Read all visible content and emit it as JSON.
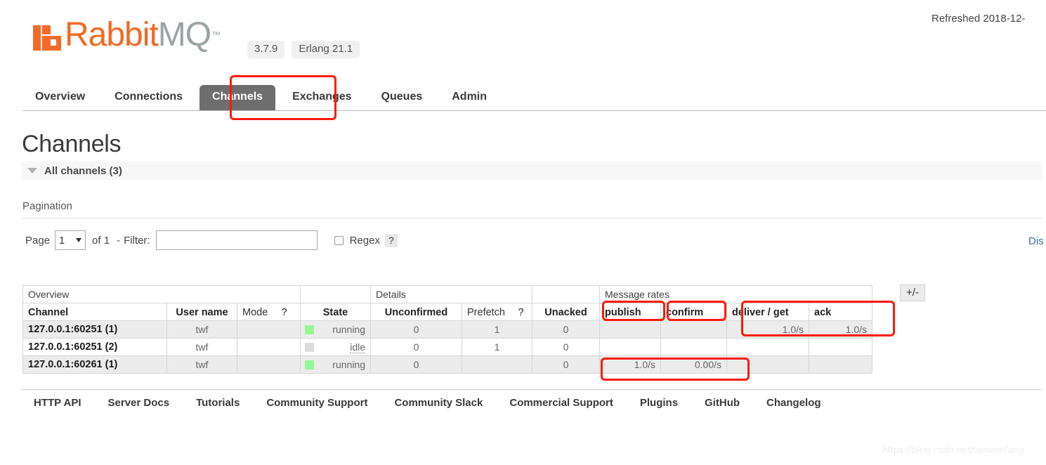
{
  "header": {
    "refreshed": "Refreshed 2018-12-",
    "logo_rabbit": "Rabbit",
    "logo_mq": "MQ",
    "logo_tm": "™",
    "version": "3.7.9",
    "erlang_version": "Erlang 21.1"
  },
  "nav": {
    "items": [
      {
        "label": "Overview",
        "active": false
      },
      {
        "label": "Connections",
        "active": false
      },
      {
        "label": "Channels",
        "active": true
      },
      {
        "label": "Exchanges",
        "active": false
      },
      {
        "label": "Queues",
        "active": false
      },
      {
        "label": "Admin",
        "active": false
      }
    ]
  },
  "page": {
    "title": "Channels",
    "section_title": "All channels (3)"
  },
  "pagination": {
    "label": "Pagination",
    "page_label": "Page",
    "page_value": "1",
    "of_text": "of 1",
    "dash": "-",
    "filter_label": "Filter:",
    "filter_value": "",
    "regex_label": "Regex",
    "help_marker": "?",
    "displaying": "Dis"
  },
  "table": {
    "group_headers": [
      {
        "label": "Overview",
        "span": 4
      },
      {
        "label": "Details",
        "span": 3
      },
      {
        "label": "Message rates",
        "span": 4
      }
    ],
    "columns": [
      "Channel",
      "User name",
      "Mode",
      "?",
      "State",
      "Unconfirmed",
      "Prefetch",
      "?",
      "Unacked",
      "publish",
      "confirm",
      "deliver / get",
      "ack"
    ],
    "rows": [
      {
        "channel": "127.0.0.1:60251 (1)",
        "user_name": "twf",
        "mode": "",
        "state": "running",
        "state_color": "green",
        "unconfirmed": "0",
        "prefetch": "1",
        "unacked": "0",
        "publish": "",
        "confirm": "",
        "deliver_get": "1.0/s",
        "ack": "1.0/s"
      },
      {
        "channel": "127.0.0.1:60251 (2)",
        "user_name": "twf",
        "mode": "",
        "state": "idle",
        "state_color": "grey",
        "unconfirmed": "0",
        "prefetch": "1",
        "unacked": "0",
        "publish": "",
        "confirm": "",
        "deliver_get": "",
        "ack": ""
      },
      {
        "channel": "127.0.0.1:60261 (1)",
        "user_name": "twf",
        "mode": "",
        "state": "running",
        "state_color": "green",
        "unconfirmed": "0",
        "prefetch": "",
        "unacked": "0",
        "publish": "1.0/s",
        "confirm": "0.00/s",
        "deliver_get": "",
        "ack": ""
      }
    ],
    "toggle_columns_label": "+/-"
  },
  "footer": {
    "links": [
      "HTTP API",
      "Server Docs",
      "Tutorials",
      "Community Support",
      "Community Slack",
      "Commercial Support",
      "Plugins",
      "GitHub",
      "Changelog"
    ]
  },
  "watermark": "https://blog.csdn.net/tanwenfang",
  "colors": {
    "brand_orange": "#f26a27",
    "logo_grey": "#9aa4a4",
    "active_tab_bg": "#6e6e6e",
    "annotation_red": "#fb1c08",
    "state_running": "#97f797",
    "state_idle": "#dcdcdc",
    "row_alt_bg": "#ececec"
  }
}
